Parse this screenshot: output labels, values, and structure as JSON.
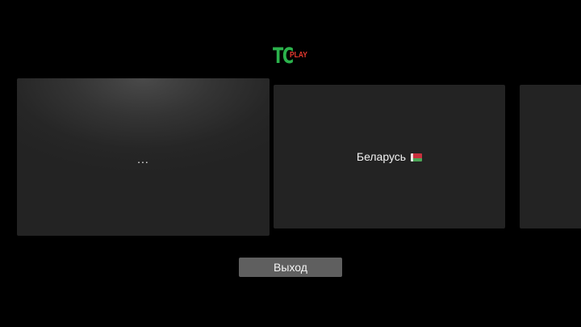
{
  "app": {
    "logo": {
      "main": "TC",
      "sub": "PLAY",
      "main_color": "#2bb24c",
      "sub_color": "#e8392f"
    }
  },
  "carousel": {
    "items": [
      {
        "label": "...",
        "state": "focused"
      },
      {
        "label": "Беларусь",
        "icon": "belarus-flag-icon"
      },
      {
        "label": ""
      }
    ]
  },
  "flag": {
    "red": "#c8313e",
    "green": "#4aa657"
  },
  "footer": {
    "exit_label": "Выход"
  }
}
